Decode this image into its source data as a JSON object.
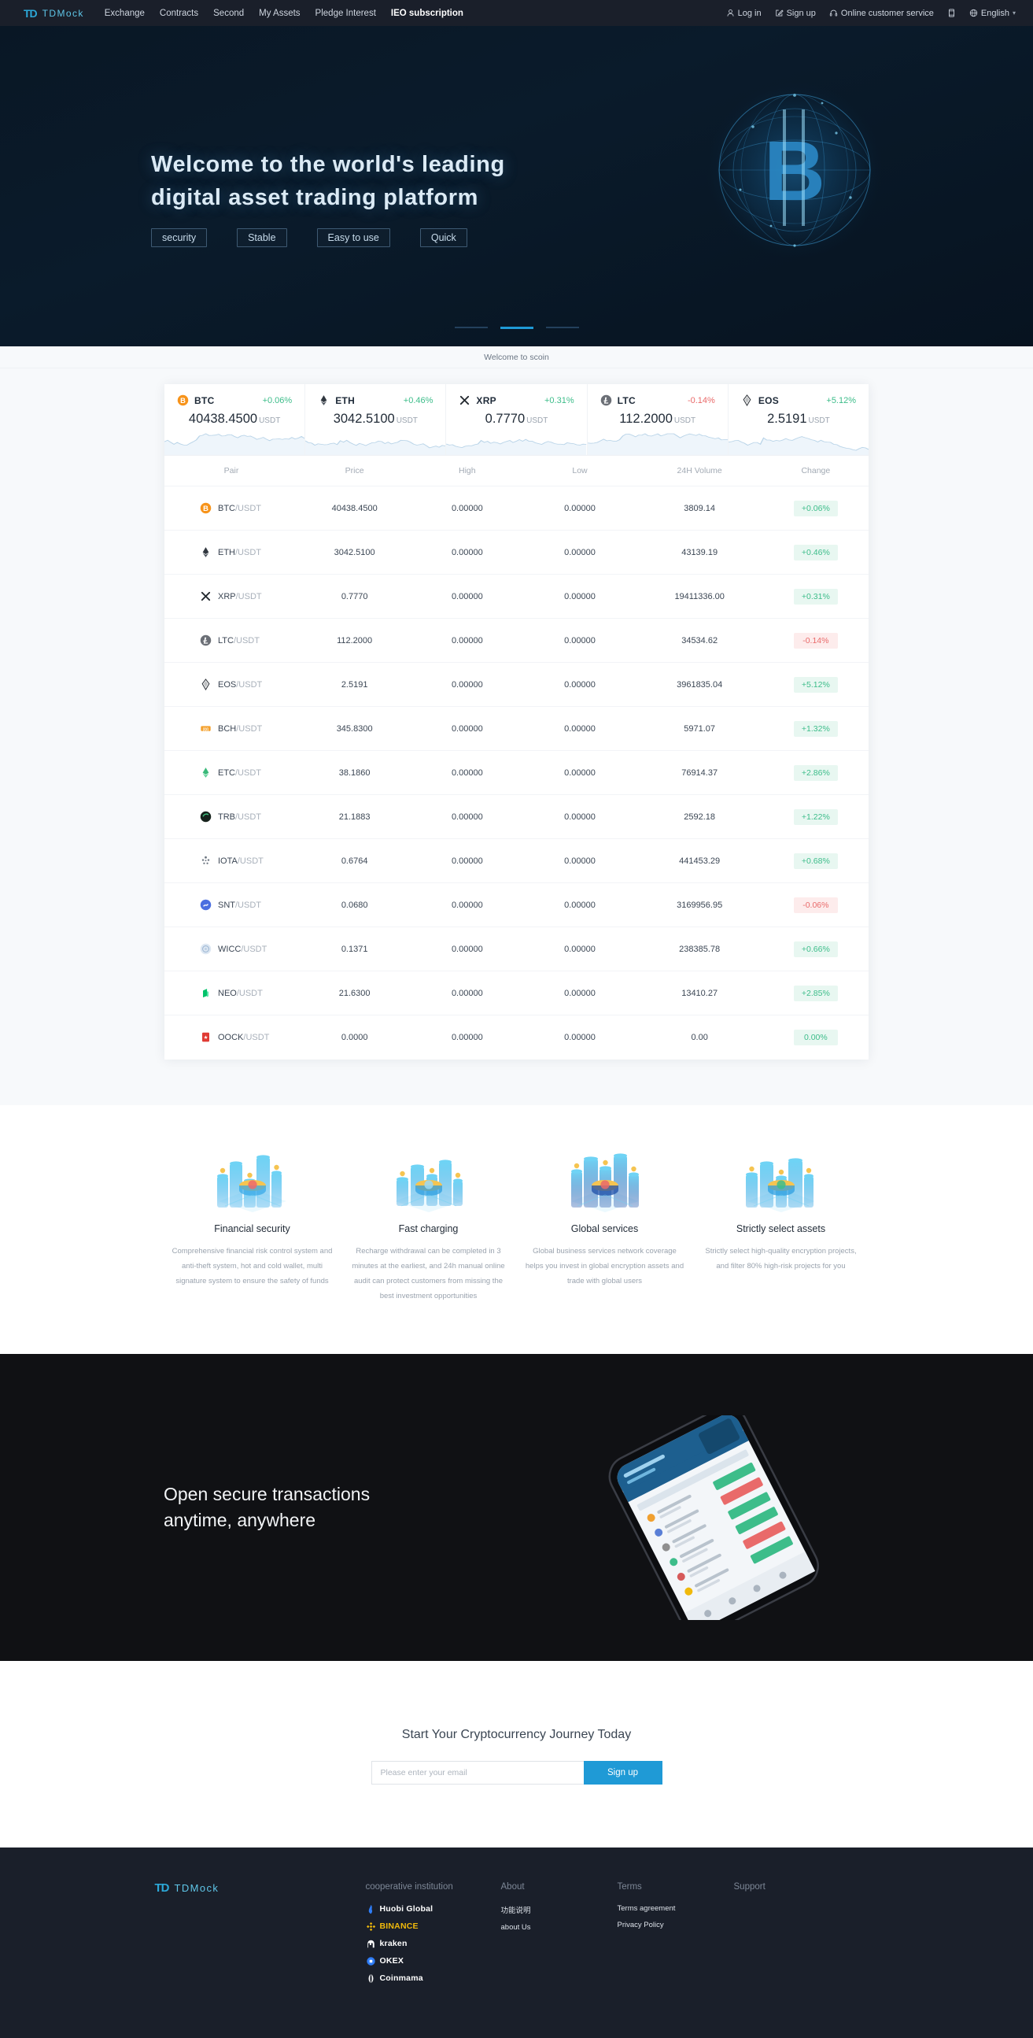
{
  "header": {
    "brand_mark": "TD",
    "brand_name": "TDMock",
    "nav": [
      {
        "label": "Exchange",
        "active": false
      },
      {
        "label": "Contracts",
        "active": false
      },
      {
        "label": "Second",
        "active": false
      },
      {
        "label": "My Assets",
        "active": false
      },
      {
        "label": "Pledge Interest",
        "active": false
      },
      {
        "label": "IEO subscription",
        "active": true
      }
    ],
    "login": "Log in",
    "signup": "Sign up",
    "support": "Online customer service",
    "language": "English"
  },
  "hero": {
    "line1": "Welcome to the world's leading",
    "line2": "digital asset trading platform",
    "tags": [
      "security",
      "Stable",
      "Easy to use",
      "Quick"
    ],
    "carousel_active_index": 1,
    "carousel_count": 3
  },
  "welcome_strip": {
    "text": "Welcome to scoin"
  },
  "tickers": [
    {
      "symbol": "BTC",
      "change": "+0.06%",
      "dir": "up",
      "price": "40438.4500",
      "unit": "USDT",
      "icon": "btc-icon"
    },
    {
      "symbol": "ETH",
      "change": "+0.46%",
      "dir": "up",
      "price": "3042.5100",
      "unit": "USDT",
      "icon": "eth-icon"
    },
    {
      "symbol": "XRP",
      "change": "+0.31%",
      "dir": "up",
      "price": "0.7770",
      "unit": "USDT",
      "icon": "xrp-icon"
    },
    {
      "symbol": "LTC",
      "change": "-0.14%",
      "dir": "down",
      "price": "112.2000",
      "unit": "USDT",
      "icon": "ltc-icon"
    },
    {
      "symbol": "EOS",
      "change": "+5.12%",
      "dir": "up",
      "price": "2.5191",
      "unit": "USDT",
      "icon": "eos-icon"
    }
  ],
  "market_table": {
    "columns": [
      "Pair",
      "Price",
      "High",
      "Low",
      "24H Volume",
      "Change"
    ],
    "quote": "/USDT",
    "rows": [
      {
        "base": "BTC",
        "icon": "btc-icon",
        "price": "40438.4500",
        "price_dir": "up",
        "high": "0.00000",
        "low": "0.00000",
        "volume": "3809.14",
        "change": "+0.06%",
        "dir": "up"
      },
      {
        "base": "ETH",
        "icon": "eth-icon",
        "price": "3042.5100",
        "price_dir": "up",
        "high": "0.00000",
        "low": "0.00000",
        "volume": "43139.19",
        "change": "+0.46%",
        "dir": "up"
      },
      {
        "base": "XRP",
        "icon": "xrp-icon",
        "price": "0.7770",
        "price_dir": "up",
        "high": "0.00000",
        "low": "0.00000",
        "volume": "19411336.00",
        "change": "+0.31%",
        "dir": "up"
      },
      {
        "base": "LTC",
        "icon": "ltc-icon",
        "price": "112.2000",
        "price_dir": "down",
        "high": "0.00000",
        "low": "0.00000",
        "volume": "34534.62",
        "change": "-0.14%",
        "dir": "down"
      },
      {
        "base": "EOS",
        "icon": "eos-icon",
        "price": "2.5191",
        "price_dir": "up",
        "high": "0.00000",
        "low": "0.00000",
        "volume": "3961835.04",
        "change": "+5.12%",
        "dir": "up"
      },
      {
        "base": "BCH",
        "icon": "bch-icon",
        "price": "345.8300",
        "price_dir": "up",
        "high": "0.00000",
        "low": "0.00000",
        "volume": "5971.07",
        "change": "+1.32%",
        "dir": "up"
      },
      {
        "base": "ETC",
        "icon": "etc-icon",
        "price": "38.1860",
        "price_dir": "up",
        "high": "0.00000",
        "low": "0.00000",
        "volume": "76914.37",
        "change": "+2.86%",
        "dir": "up"
      },
      {
        "base": "TRB",
        "icon": "trb-icon",
        "price": "21.1883",
        "price_dir": "up",
        "high": "0.00000",
        "low": "0.00000",
        "volume": "2592.18",
        "change": "+1.22%",
        "dir": "up"
      },
      {
        "base": "IOTA",
        "icon": "iota-icon",
        "price": "0.6764",
        "price_dir": "up",
        "high": "0.00000",
        "low": "0.00000",
        "volume": "441453.29",
        "change": "+0.68%",
        "dir": "up"
      },
      {
        "base": "SNT",
        "icon": "snt-icon",
        "price": "0.0680",
        "price_dir": "down",
        "high": "0.00000",
        "low": "0.00000",
        "volume": "3169956.95",
        "change": "-0.06%",
        "dir": "down"
      },
      {
        "base": "WICC",
        "icon": "wicc-icon",
        "price": "0.1371",
        "price_dir": "up",
        "high": "0.00000",
        "low": "0.00000",
        "volume": "238385.78",
        "change": "+0.66%",
        "dir": "up"
      },
      {
        "base": "NEO",
        "icon": "neo-icon",
        "price": "21.6300",
        "price_dir": "up",
        "high": "0.00000",
        "low": "0.00000",
        "volume": "13410.27",
        "change": "+2.85%",
        "dir": "up"
      },
      {
        "base": "OOCK",
        "icon": "oock-icon",
        "price": "0.0000",
        "price_dir": "up",
        "high": "0.00000",
        "low": "0.00000",
        "volume": "0.00",
        "change": "0.00%",
        "dir": "up"
      }
    ]
  },
  "features": [
    {
      "title": "Financial security",
      "desc": "Comprehensive financial risk control system and anti-theft system, hot and cold wallet, multi signature system to ensure the safety of funds",
      "art": "financial-security-illustration"
    },
    {
      "title": "Fast charging",
      "desc": "Recharge withdrawal can be completed in 3 minutes at the earliest, and 24h manual online audit can protect customers from missing the best investment opportunities",
      "art": "fast-charging-illustration"
    },
    {
      "title": "Global services",
      "desc": "Global business services network coverage helps you invest in global encryption assets and trade with global users",
      "art": "global-services-illustration"
    },
    {
      "title": "Strictly select assets",
      "desc": "Strictly select high-quality encryption projects, and filter 80% high-risk projects for you",
      "art": "select-assets-illustration"
    }
  ],
  "app_band": {
    "line1": "Open secure transactions",
    "line2": "anytime, anywhere"
  },
  "cta": {
    "title": "Start Your Cryptocurrency Journey Today",
    "placeholder": "Please enter your email",
    "input_value": "",
    "button": "Sign up"
  },
  "footer": {
    "brand_mark": "TD",
    "brand_name": "TDMock",
    "partners_head": "cooperative institution",
    "partners": [
      {
        "name": "Huobi Global",
        "icon": "huobi-icon",
        "color": "#ffffff",
        "accent": "#2e7cf6"
      },
      {
        "name": "BINANCE",
        "icon": "binance-icon",
        "color": "#f0b90b",
        "accent": "#f0b90b"
      },
      {
        "name": "kraken",
        "icon": "kraken-icon",
        "color": "#ffffff",
        "accent": "#ffffff"
      },
      {
        "name": "OKEX",
        "icon": "okex-icon",
        "color": "#ffffff",
        "accent": "#2e7cf6"
      },
      {
        "name": "Coinmama",
        "icon": "coinmama-icon",
        "color": "#ffffff",
        "accent": "#ffffff"
      }
    ],
    "about_head": "About",
    "about_links": [
      "功能说明",
      "about Us"
    ],
    "terms_head": "Terms",
    "terms_links": [
      "Terms agreement",
      "Privacy Policy"
    ],
    "support_head": "Support"
  },
  "colors": {
    "accent": "#1f9ad6",
    "brand": "#5fc6e8",
    "up": "#3dbd8a",
    "down": "#e96a6a",
    "dark": "#1a1f2a"
  }
}
